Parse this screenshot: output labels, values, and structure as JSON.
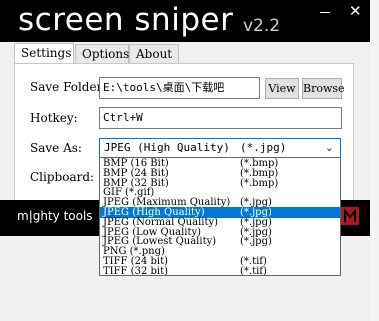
{
  "window": {
    "title": "screen sniper",
    "version": "v2.2"
  },
  "tabs": [
    "Settings",
    "Options",
    "About"
  ],
  "settings": {
    "save_folder_label": "Save Folder",
    "save_folder_value": "E:\\tools\\桌面\\下载吧",
    "view_button": "View",
    "browse_button": "Browse",
    "hotkey_label": "Hotkey:",
    "hotkey_value": "Ctrl+W",
    "save_as_label": "Save As:",
    "save_as_selected": "JPEG (High Quality)",
    "save_as_selected_ext": "(*.jpg)",
    "clipboard_label": "Clipboard:"
  },
  "dropdown_options": [
    {
      "name": "BMP (16 Bit)",
      "ext": "(*.bmp)"
    },
    {
      "name": "BMP (24 Bit)",
      "ext": "(*.bmp)"
    },
    {
      "name": "BMP (32 Bit)",
      "ext": "(*.bmp)"
    },
    {
      "name": "GIF (*.gif)",
      "ext": ""
    },
    {
      "name": "JPEG (Maximum Quality)",
      "ext": "(*.jpg)"
    },
    {
      "name": "JPEG (High Quality)",
      "ext": "(*.jpg)"
    },
    {
      "name": "JPEG (Normal Quality)",
      "ext": "(*.jpg)"
    },
    {
      "name": "JPEG (Low Quality)",
      "ext": "(*.jpg)"
    },
    {
      "name": "JPEG (Lowest Quality)",
      "ext": "(*.jpg)"
    },
    {
      "name": "PNG (*.png)",
      "ext": ""
    },
    {
      "name": "TIFF (24 bit)",
      "ext": "(*.tif)"
    },
    {
      "name": "TIFF (32 bit)",
      "ext": "(*.tif)"
    }
  ],
  "selected_option_index": 5,
  "footer": {
    "brand": "m|ghty tools"
  },
  "colors": {
    "accent": "#0078d7",
    "titlebar": "#000000",
    "logo": "#b0171f"
  }
}
